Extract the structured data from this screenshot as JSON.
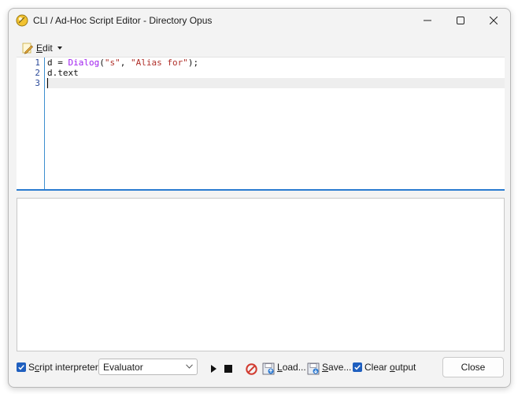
{
  "window": {
    "title": "CLI / Ad-Hoc Script Editor - Directory Opus"
  },
  "toolbar": {
    "edit_label_underlined": "E",
    "edit_label_rest": "dit"
  },
  "editor": {
    "line_numbers": [
      "1",
      "2",
      "3"
    ],
    "lines": [
      {
        "tokens": [
          {
            "text": "d = ",
            "cls": ""
          },
          {
            "text": "Dialog",
            "cls": "kw"
          },
          {
            "text": "(",
            "cls": ""
          },
          {
            "text": "\"s\"",
            "cls": "str"
          },
          {
            "text": ", ",
            "cls": ""
          },
          {
            "text": "\"Alias for\"",
            "cls": "str"
          },
          {
            "text": ");",
            "cls": ""
          }
        ]
      },
      {
        "tokens": [
          {
            "text": "d.text",
            "cls": ""
          }
        ]
      },
      {
        "tokens": []
      }
    ]
  },
  "footer": {
    "script_interpreter_checked": true,
    "script_interpreter_label_prefix": "S",
    "script_interpreter_label_underlined": "c",
    "script_interpreter_label_rest": "ript interpreter:",
    "interpreter_value": "Evaluator",
    "load_label_underlined": "L",
    "load_label_rest": "oad...",
    "save_label_underlined": "S",
    "save_label_rest": "ave...",
    "clear_output_checked": true,
    "clear_output_label_prefix": "Clear ",
    "clear_output_label_underlined": "o",
    "clear_output_label_rest": "utput",
    "close_label": "Close"
  },
  "colors": {
    "accent": "#2a7bd0",
    "checkbox": "#1f5fbf",
    "keyword": "#a020f0",
    "string": "#b0302a",
    "no_entry_icon": "#d13a2f"
  }
}
